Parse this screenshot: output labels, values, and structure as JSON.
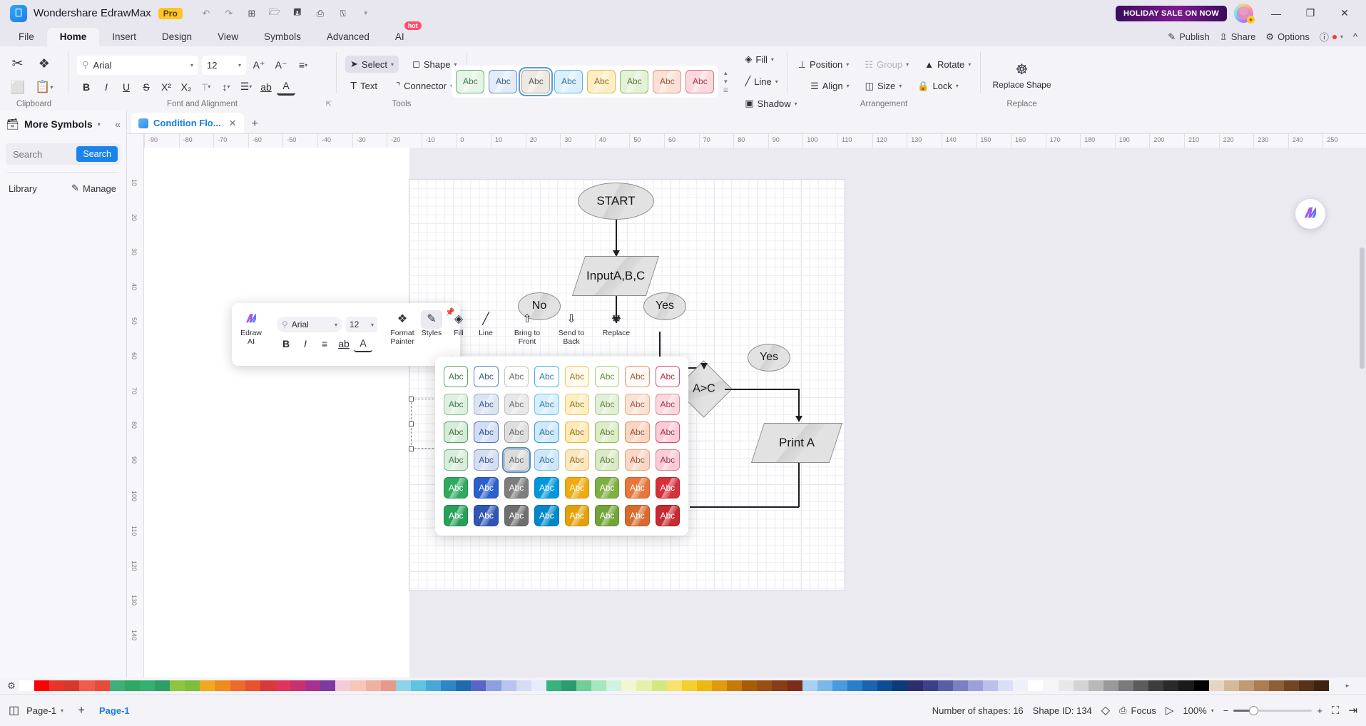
{
  "titlebar": {
    "app_name": "Wondershare EdrawMax",
    "badge": "Pro",
    "quick_actions": [
      "undo-icon",
      "redo-icon",
      "new-icon",
      "open-icon",
      "save-icon",
      "print-icon",
      "export-icon",
      "more-icon"
    ],
    "sale_banner": "HOLIDAY SALE ON NOW",
    "minimize": "—",
    "maximize": "❐",
    "close": "✕"
  },
  "menubar": {
    "items": [
      "File",
      "Home",
      "Insert",
      "Design",
      "View",
      "Symbols",
      "Advanced",
      "AI"
    ],
    "active": "Home",
    "ai_hot": "hot",
    "right": [
      "Publish",
      "Share",
      "Options"
    ]
  },
  "ribbon": {
    "clipboard": {
      "label": "Clipboard",
      "cut": "cut-icon",
      "format_painter": "format-painter-icon",
      "copy": "copy-icon",
      "paste": "paste-icon"
    },
    "font": {
      "label": "Font and Alignment",
      "font_family": "Arial",
      "font_size": "12",
      "grow": "A⁺",
      "shrink": "A⁻",
      "bold": "B",
      "italic": "I",
      "underline": "U",
      "strike": "S",
      "superscript": "X²",
      "subscript": "X₂",
      "text_color": "A",
      "highlight": "ab"
    },
    "tools": {
      "label": "Tools",
      "select": "Select",
      "shape": "Shape",
      "text": "Text",
      "connector": "Connector"
    },
    "styles": {
      "label": "Styles",
      "swatches": [
        {
          "fill": "#e5f4e6",
          "border": "#68b36d",
          "text": "#3c7a42",
          "label": "Abc"
        },
        {
          "fill": "#e3eaf8",
          "border": "#6b8cc4",
          "text": "#3b5c93",
          "label": "Abc"
        },
        {
          "fill": "#ece9e2",
          "border": "#a9a49a",
          "text": "#5d5a52",
          "label": "Abc"
        },
        {
          "fill": "#dcefff",
          "border": "#62aee6",
          "text": "#2e6d9e",
          "label": "Abc"
        },
        {
          "fill": "#fdeec6",
          "border": "#e0b94e",
          "text": "#8a6a15",
          "label": "Abc"
        },
        {
          "fill": "#e4f1d7",
          "border": "#8cb95e",
          "text": "#557a2c",
          "label": "Abc"
        },
        {
          "fill": "#fbe0d5",
          "border": "#e0957a",
          "text": "#9b5438",
          "label": "Abc"
        },
        {
          "fill": "#fbd9dd",
          "border": "#d8758a",
          "text": "#9c3b4c",
          "label": "Abc"
        }
      ],
      "selected_index": 2
    },
    "fill_group": {
      "fill": "Fill",
      "line": "Line",
      "shadow": "Shadow"
    },
    "arrangement": {
      "label": "Arrangement",
      "position": "Position",
      "group": "Group",
      "rotate": "Rotate",
      "align": "Align",
      "size": "Size",
      "lock": "Lock"
    },
    "replace": {
      "label": "Replace",
      "replace_shape": "Replace Shape"
    }
  },
  "leftpanel": {
    "title": "More Symbols",
    "collapse": "«",
    "search_placeholder": "Search",
    "search_button": "Search",
    "library": "Library",
    "manage": "Manage"
  },
  "doctab": {
    "name": "Condition Flo...",
    "close": "✕",
    "add": "+"
  },
  "rulers": {
    "h_ticks": [
      "-90",
      "-80",
      "-70",
      "-60",
      "-50",
      "-40",
      "-30",
      "-20",
      "-10",
      "0",
      "10",
      "20",
      "30",
      "40",
      "50",
      "60",
      "70",
      "80",
      "90",
      "100",
      "110",
      "120",
      "130",
      "140",
      "150",
      "160",
      "170",
      "180",
      "190",
      "200",
      "210",
      "220",
      "230",
      "240",
      "250"
    ],
    "v_ticks": [
      "10",
      "20",
      "30",
      "40",
      "50",
      "60",
      "70",
      "80",
      "90",
      "100",
      "110",
      "120",
      "130",
      "140"
    ]
  },
  "diagram": {
    "shapes": [
      {
        "id": "start",
        "label": "START",
        "type": "ellipse"
      },
      {
        "id": "input",
        "label": "Input\nA,B,C",
        "type": "parallelogram"
      },
      {
        "id": "no",
        "label": "No",
        "type": "ellipse"
      },
      {
        "id": "yes1",
        "label": "Yes",
        "type": "ellipse"
      },
      {
        "id": "cond",
        "label": "A>C",
        "type": "diamond"
      },
      {
        "id": "yes2",
        "label": "Yes",
        "type": "ellipse"
      },
      {
        "id": "print",
        "label": "Print A",
        "type": "parallelogram"
      }
    ]
  },
  "floatbar": {
    "edraw_ai": "Edraw AI",
    "font_family": "Arial",
    "font_size": "12",
    "bold": "B",
    "italic": "I",
    "align": "align-icon",
    "highlight": "ab",
    "font_color": "A",
    "items": [
      {
        "label": "Format\nPainter",
        "icon": "format-painter-icon"
      },
      {
        "label": "Styles",
        "icon": "styles-icon"
      },
      {
        "label": "Fill",
        "icon": "fill-icon"
      },
      {
        "label": "Line",
        "icon": "line-icon"
      },
      {
        "label": "Bring to Front",
        "icon": "bring-to-front-icon"
      },
      {
        "label": "Send to Back",
        "icon": "send-to-back-icon"
      },
      {
        "label": "Replace",
        "icon": "replace-icon"
      }
    ]
  },
  "style_popup": {
    "label": "Abc",
    "selected_index": 26,
    "cells": [
      {
        "fill": "#ffffff",
        "border": "#5caa63",
        "text": "#3d7a45"
      },
      {
        "fill": "#ffffff",
        "border": "#5f7fbe",
        "text": "#3a5b92"
      },
      {
        "fill": "#ffffff",
        "border": "#c9c6bf",
        "text": "#6b6862"
      },
      {
        "fill": "#ffffff",
        "border": "#3eb0e8",
        "text": "#2b7aa8"
      },
      {
        "fill": "#fffaeb",
        "border": "#f0c75a",
        "text": "#9c7a1d"
      },
      {
        "fill": "#fbfef7",
        "border": "#a8cc80",
        "text": "#5f8a35"
      },
      {
        "fill": "#fffaf7",
        "border": "#ec8f6a",
        "text": "#a85636"
      },
      {
        "fill": "#fffafb",
        "border": "#d3566f",
        "text": "#a23447"
      },
      {
        "fill": "#dff0e2",
        "border": "#8ec297",
        "text": "#3f7a4a"
      },
      {
        "fill": "#dce4f2",
        "border": "#9badd0",
        "text": "#3b5c92"
      },
      {
        "fill": "#e8e8e8",
        "border": "#c3c3c3",
        "text": "#6b6b6b"
      },
      {
        "fill": "#d7eefc",
        "border": "#6cc3ea",
        "text": "#2c79a8"
      },
      {
        "fill": "#ffeec2",
        "border": "#eec95f",
        "text": "#96711a"
      },
      {
        "fill": "#e2efd8",
        "border": "#a8cb85",
        "text": "#5d8937"
      },
      {
        "fill": "#fbe2d6",
        "border": "#eca985",
        "text": "#a2583a"
      },
      {
        "fill": "#fbd8de",
        "border": "#e08597",
        "text": "#a33a4e"
      },
      {
        "fill": "#d6ebda",
        "border": "#4fa35d",
        "text": "#3c7547"
      },
      {
        "fill": "#d3ddf4",
        "border": "#4b6fd0",
        "text": "#33529a"
      },
      {
        "fill": "#dedede",
        "border": "#9b9b9b",
        "text": "#636363"
      },
      {
        "fill": "#cfe8fa",
        "border": "#2c9fe0",
        "text": "#236e9e"
      },
      {
        "fill": "#ffe9b6",
        "border": "#e8b937",
        "text": "#8e6a12"
      },
      {
        "fill": "#dcecc9",
        "border": "#8cbb58",
        "text": "#567f2c"
      },
      {
        "fill": "#fad5c4",
        "border": "#e88a5d",
        "text": "#9a4f2f"
      },
      {
        "fill": "#fbccd6",
        "border": "#d44a67",
        "text": "#9b3246"
      },
      {
        "fill": "#d9ecdd",
        "border": "#74b183",
        "text": "#3f7b4c"
      },
      {
        "fill": "#d4ddf2",
        "border": "#7f93ce",
        "text": "#38538f"
      },
      {
        "fill": "#dcdcdc",
        "border": "#aeaeae",
        "text": "#5f5f5f"
      },
      {
        "fill": "#cfe6f8",
        "border": "#74bce5",
        "text": "#2a6f9d"
      },
      {
        "fill": "#fde6bd",
        "border": "#e9c273",
        "text": "#8d6c22"
      },
      {
        "fill": "#dbe9c8",
        "border": "#9dc273",
        "text": "#577f33"
      },
      {
        "fill": "#fad6c7",
        "border": "#ea9f7d",
        "text": "#9d5536"
      },
      {
        "fill": "#f9ccd5",
        "border": "#dd7b90",
        "text": "#9b3447"
      },
      {
        "fill": "#2faa5f",
        "border": "#229050",
        "text": "#ffffff"
      },
      {
        "fill": "#2a5fce",
        "border": "#2450af",
        "text": "#ffffff"
      },
      {
        "fill": "#7e7e7e",
        "border": "#6b6b6b",
        "text": "#ffffff"
      },
      {
        "fill": "#0097de",
        "border": "#007fbd",
        "text": "#ffffff"
      },
      {
        "fill": "#efab11",
        "border": "#cf9209",
        "text": "#ffffff"
      },
      {
        "fill": "#7eb042",
        "border": "#6a9636",
        "text": "#ffffff"
      },
      {
        "fill": "#e8763a",
        "border": "#c85f2a",
        "text": "#ffffff"
      },
      {
        "fill": "#d8303a",
        "border": "#b6232d",
        "text": "#ffffff"
      },
      {
        "fill": "#27a05a",
        "border": "#1d874b",
        "text": "#ffffff"
      },
      {
        "fill": "#2f56b3",
        "border": "#274897",
        "text": "#ffffff"
      },
      {
        "fill": "#6f6f6f",
        "border": "#5d5d5d",
        "text": "#ffffff"
      },
      {
        "fill": "#0087c9",
        "border": "#0072ab",
        "text": "#ffffff"
      },
      {
        "fill": "#e3a009",
        "border": "#c38702",
        "text": "#ffffff"
      },
      {
        "fill": "#72a437",
        "border": "#5f8b2c",
        "text": "#ffffff"
      },
      {
        "fill": "#d96a2e",
        "border": "#b95721",
        "text": "#ffffff"
      },
      {
        "fill": "#c62a33",
        "border": "#a51f27",
        "text": "#ffffff"
      }
    ]
  },
  "palette": {
    "colors": [
      "#ffffff",
      "#ff0000",
      "#e8352c",
      "#d9372c",
      "#f05b4a",
      "#e84a3c",
      "#3fae7a",
      "#2fa864",
      "#34b06f",
      "#2e9e64",
      "#8cc63f",
      "#7cbf3a",
      "#f2a81e",
      "#f08c1e",
      "#ef6b2b",
      "#e8522d",
      "#d63a3a",
      "#e0345c",
      "#c93070",
      "#a8318f",
      "#7c3ba0",
      "#f5cbd8",
      "#f7c7b8",
      "#efb1a0",
      "#e79a8c",
      "#8dd4e8",
      "#5ec4e0",
      "#49a8d6",
      "#2f86c4",
      "#1f6bb0",
      "#5b64c7",
      "#8ca0e0",
      "#b8c4ee",
      "#d6dcf5",
      "#e8ecfa",
      "#36b37e",
      "#2a9d6e",
      "#6fcf97",
      "#a8e6c0",
      "#cff3df",
      "#f2f7d0",
      "#e6f0a8",
      "#d4e87f",
      "#f7e26b",
      "#f2d02e",
      "#edb810",
      "#e09b0a",
      "#c77a07",
      "#a85c05",
      "#9a4f12",
      "#8a3c16",
      "#7a2e1a",
      "#a8d0f0",
      "#7ab8e8",
      "#4a9ade",
      "#2a7fc9",
      "#1a64b0",
      "#0f4d93",
      "#0a3c7a",
      "#2b2f6e",
      "#3c3f8a",
      "#5a5ea8",
      "#7b7fc4",
      "#9ca0da",
      "#bdc0ea",
      "#dcdef5",
      "#f0f0f8",
      "#ffffff",
      "#f5f5f5",
      "#e8e8e8",
      "#d4d4d4",
      "#b8b8b8",
      "#9a9a9a",
      "#7a7a7a",
      "#5c5c5c",
      "#3d3d3d",
      "#2a2a2a",
      "#1a1a1a",
      "#000000",
      "#e8d5c0",
      "#d4b89a",
      "#c09a74",
      "#ac7c52",
      "#8f6038",
      "#704625",
      "#553318",
      "#3d2310"
    ],
    "expand": "▸"
  },
  "statusbar": {
    "page_selector": "Page-1",
    "add_page": "+",
    "current_page": "Page-1",
    "shape_count": "Number of shapes: 16",
    "shape_id": "Shape ID: 134",
    "focus": "Focus",
    "zoom": "100%",
    "zoom_out": "−",
    "zoom_in": "+"
  }
}
